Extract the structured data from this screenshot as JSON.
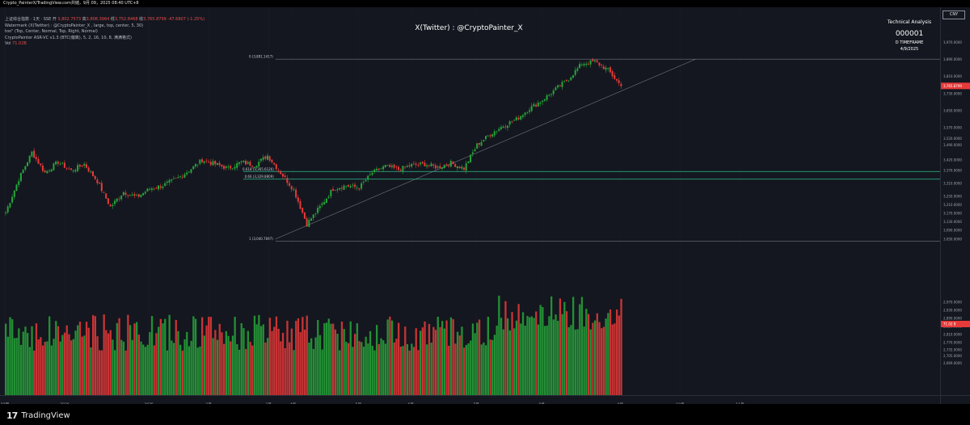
{
  "window": {
    "title": "Crypto_PainterX/TradingView.com共储，9月 09，2025 08:40 UTC+8"
  },
  "legend": {
    "symbol_line_prefix": "上证综合指数 · 1天 · SSE  开",
    "open": "3,802.7573",
    "high_label": "高",
    "high": "3,808.3964",
    "low_label": "低",
    "low": "3,752.8468",
    "close_label": "收",
    "close": "3,765.8799",
    "change": "-47.6807 (-1.25%)",
    "line2": "Watermark (X(Twitter) : @CryptoPainter_X , large, top, center, 5, 30)",
    "line3": "too\" (Top, Center, Normal, Top, Right, Normal)",
    "line4": "CryptoPainter ASR-VC v1.3 (BTC(偏离), 5, 2, 16, 10, 8, 满满格式)",
    "vol_label": "Vol",
    "vol_value": "71.02B"
  },
  "watermark": "X(Twitter) : @CryptoPainter_X",
  "ta_box": {
    "title": "Technical Analysis",
    "code": "000001",
    "timeframe": "D TIMEFRAME",
    "date": "4/9/2025"
  },
  "currency_button": "CNY",
  "colors": {
    "up": "#26a63a",
    "down": "#e83a3a",
    "background": "#14171f",
    "fib": "#2fbf8f"
  },
  "fib_levels": [
    {
      "ratio": "0",
      "label": "0 (3,891.1417)",
      "price": 3891.1417
    },
    {
      "ratio": "0.618",
      "label": "0.618 (3,365.6126)",
      "price": 3365.6126
    },
    {
      "ratio": "0.66",
      "label": "0.66 (3,329.8809)",
      "price": 3329.8809
    },
    {
      "ratio": "1",
      "label": "1 (3,040.7697)",
      "price": 3040.7697
    }
  ],
  "chart_data": {
    "type": "candlestick",
    "symbol": "上证综合指数",
    "timeframe": "1D",
    "price_axis": {
      "range": [
        2630,
        3990
      ],
      "ticks": [
        "3,970.0000",
        "3,890.0000",
        "3,810.0000",
        "3,730.0000",
        "3,650.0000",
        "3,570.0000",
        "3,520.0000",
        "3,490.0000",
        "3,420.0000",
        "3,370.0000",
        "3,310.0000",
        "3,250.0000",
        "3,210.0000",
        "3,170.0000",
        "3,130.0000",
        "3,090.0000",
        "3,050.0000",
        "2,970.0000",
        "2,930.0000",
        "2,890.0000",
        "2,850.0000",
        "2,810.0000",
        "2,770.0000",
        "2,735.0000",
        "2,705.0000",
        "2,669.0000"
      ]
    },
    "time_axis": {
      "labels": [
        "12月",
        "2025",
        "2月",
        "3月",
        "4月",
        "5月",
        "6月",
        "7月",
        "8月",
        "9月",
        "10月",
        "11月",
        "12月",
        "2026"
      ]
    },
    "last_price": "3,765.8799",
    "last_volume": "71.02 B",
    "anchors": [
      [
        3175,
        "12月"
      ],
      [
        3330,
        null
      ],
      [
        3455,
        null
      ],
      [
        3360,
        null
      ],
      [
        3410,
        null
      ],
      [
        3370,
        null
      ],
      [
        3400,
        null
      ],
      [
        3320,
        null
      ],
      [
        3200,
        null
      ],
      [
        3270,
        null
      ],
      [
        3245,
        null
      ],
      [
        3285,
        "2025"
      ],
      [
        3300,
        null
      ],
      [
        3330,
        null
      ],
      [
        3370,
        null
      ],
      [
        3420,
        null
      ],
      [
        3400,
        null
      ],
      [
        3380,
        null
      ],
      [
        3410,
        null
      ],
      [
        3395,
        null
      ],
      [
        3440,
        null
      ],
      [
        3360,
        null
      ],
      [
        3280,
        "4月"
      ],
      [
        3120,
        null
      ],
      [
        3200,
        null
      ],
      [
        3285,
        null
      ],
      [
        3300,
        null
      ],
      [
        3290,
        "5月"
      ],
      [
        3360,
        null
      ],
      [
        3390,
        null
      ],
      [
        3375,
        null
      ],
      [
        3395,
        "6月"
      ],
      [
        3400,
        null
      ],
      [
        3385,
        null
      ],
      [
        3405,
        null
      ],
      [
        3380,
        null
      ],
      [
        3490,
        "7月"
      ],
      [
        3540,
        null
      ],
      [
        3580,
        null
      ],
      [
        3610,
        null
      ],
      [
        3660,
        null
      ],
      [
        3700,
        "8月"
      ],
      [
        3750,
        null
      ],
      [
        3800,
        null
      ],
      [
        3870,
        null
      ],
      [
        3880,
        null
      ],
      [
        3840,
        null
      ],
      [
        3765,
        "9月"
      ]
    ]
  }
}
